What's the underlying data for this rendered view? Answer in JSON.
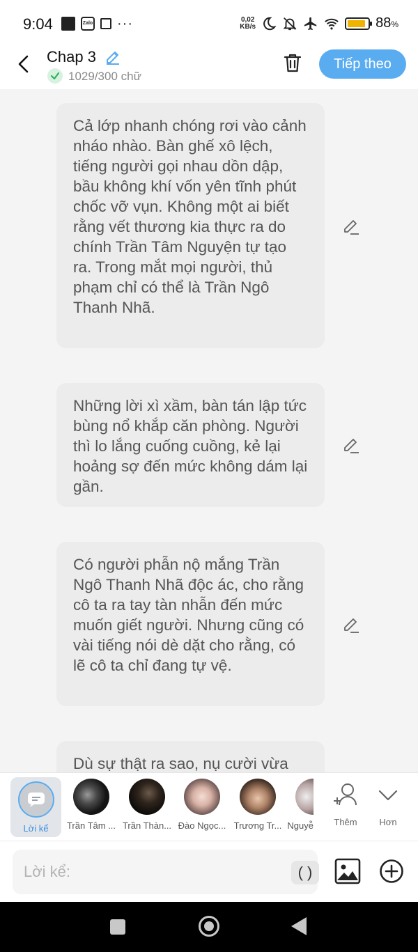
{
  "status_bar": {
    "time": "9:04",
    "zalo_label": "Zalo",
    "dots": "···",
    "speed_value": "0,02",
    "speed_unit": "KB/s",
    "battery_percent": "88",
    "battery_unit": "%",
    "battery_level": 0.88,
    "battery_color": "#f0b400"
  },
  "header": {
    "title": "Chap 3",
    "word_count": "1029/300 chữ",
    "next_label": "Tiếp theo",
    "accent_color": "#5aacf0"
  },
  "messages": [
    {
      "text": "Cả lớp nhanh chóng rơi vào cảnh nháo nhào. Bàn ghế xô lệch, tiếng người gọi nhau dồn dập, bầu không khí vốn yên tĩnh phút chốc vỡ vụn. Không một ai biết rằng vết thương kia thực ra do chính Trần Tâm Nguyện tự tạo ra. Trong mắt mọi người, thủ phạm chỉ có thể là Trần Ngô Thanh Nhã."
    },
    {
      "text": "Những lời xì xầm, bàn tán lập tức bùng nổ khắp căn phòng. Người thì lo lắng cuống cuồng, kẻ lại hoảng sợ đến mức không dám lại gần."
    },
    {
      "text": "Có người phẫn nộ mắng Trần Ngô Thanh Nhã độc ác, cho rằng cô ta ra tay tàn nhẫn đến mức muốn giết người. Nhưng cũng có vài tiếng nói dè dặt cho rằng, có lẽ cô ta chỉ đang tự vệ."
    },
    {
      "text": "Dù sự thật ra sao, nụ cười vừa"
    }
  ],
  "characters": {
    "narrator_label": "Lời kể",
    "items": [
      {
        "name": "Trần Tâm ..."
      },
      {
        "name": "Trần Thàn..."
      },
      {
        "name": "Đào Ngọc..."
      },
      {
        "name": "Trương Tr..."
      },
      {
        "name": "Nguyễ"
      }
    ],
    "add_label": "Thêm",
    "more_label": "Hơn"
  },
  "composer": {
    "placeholder": "Lời kể:",
    "paren_label": "( )"
  }
}
